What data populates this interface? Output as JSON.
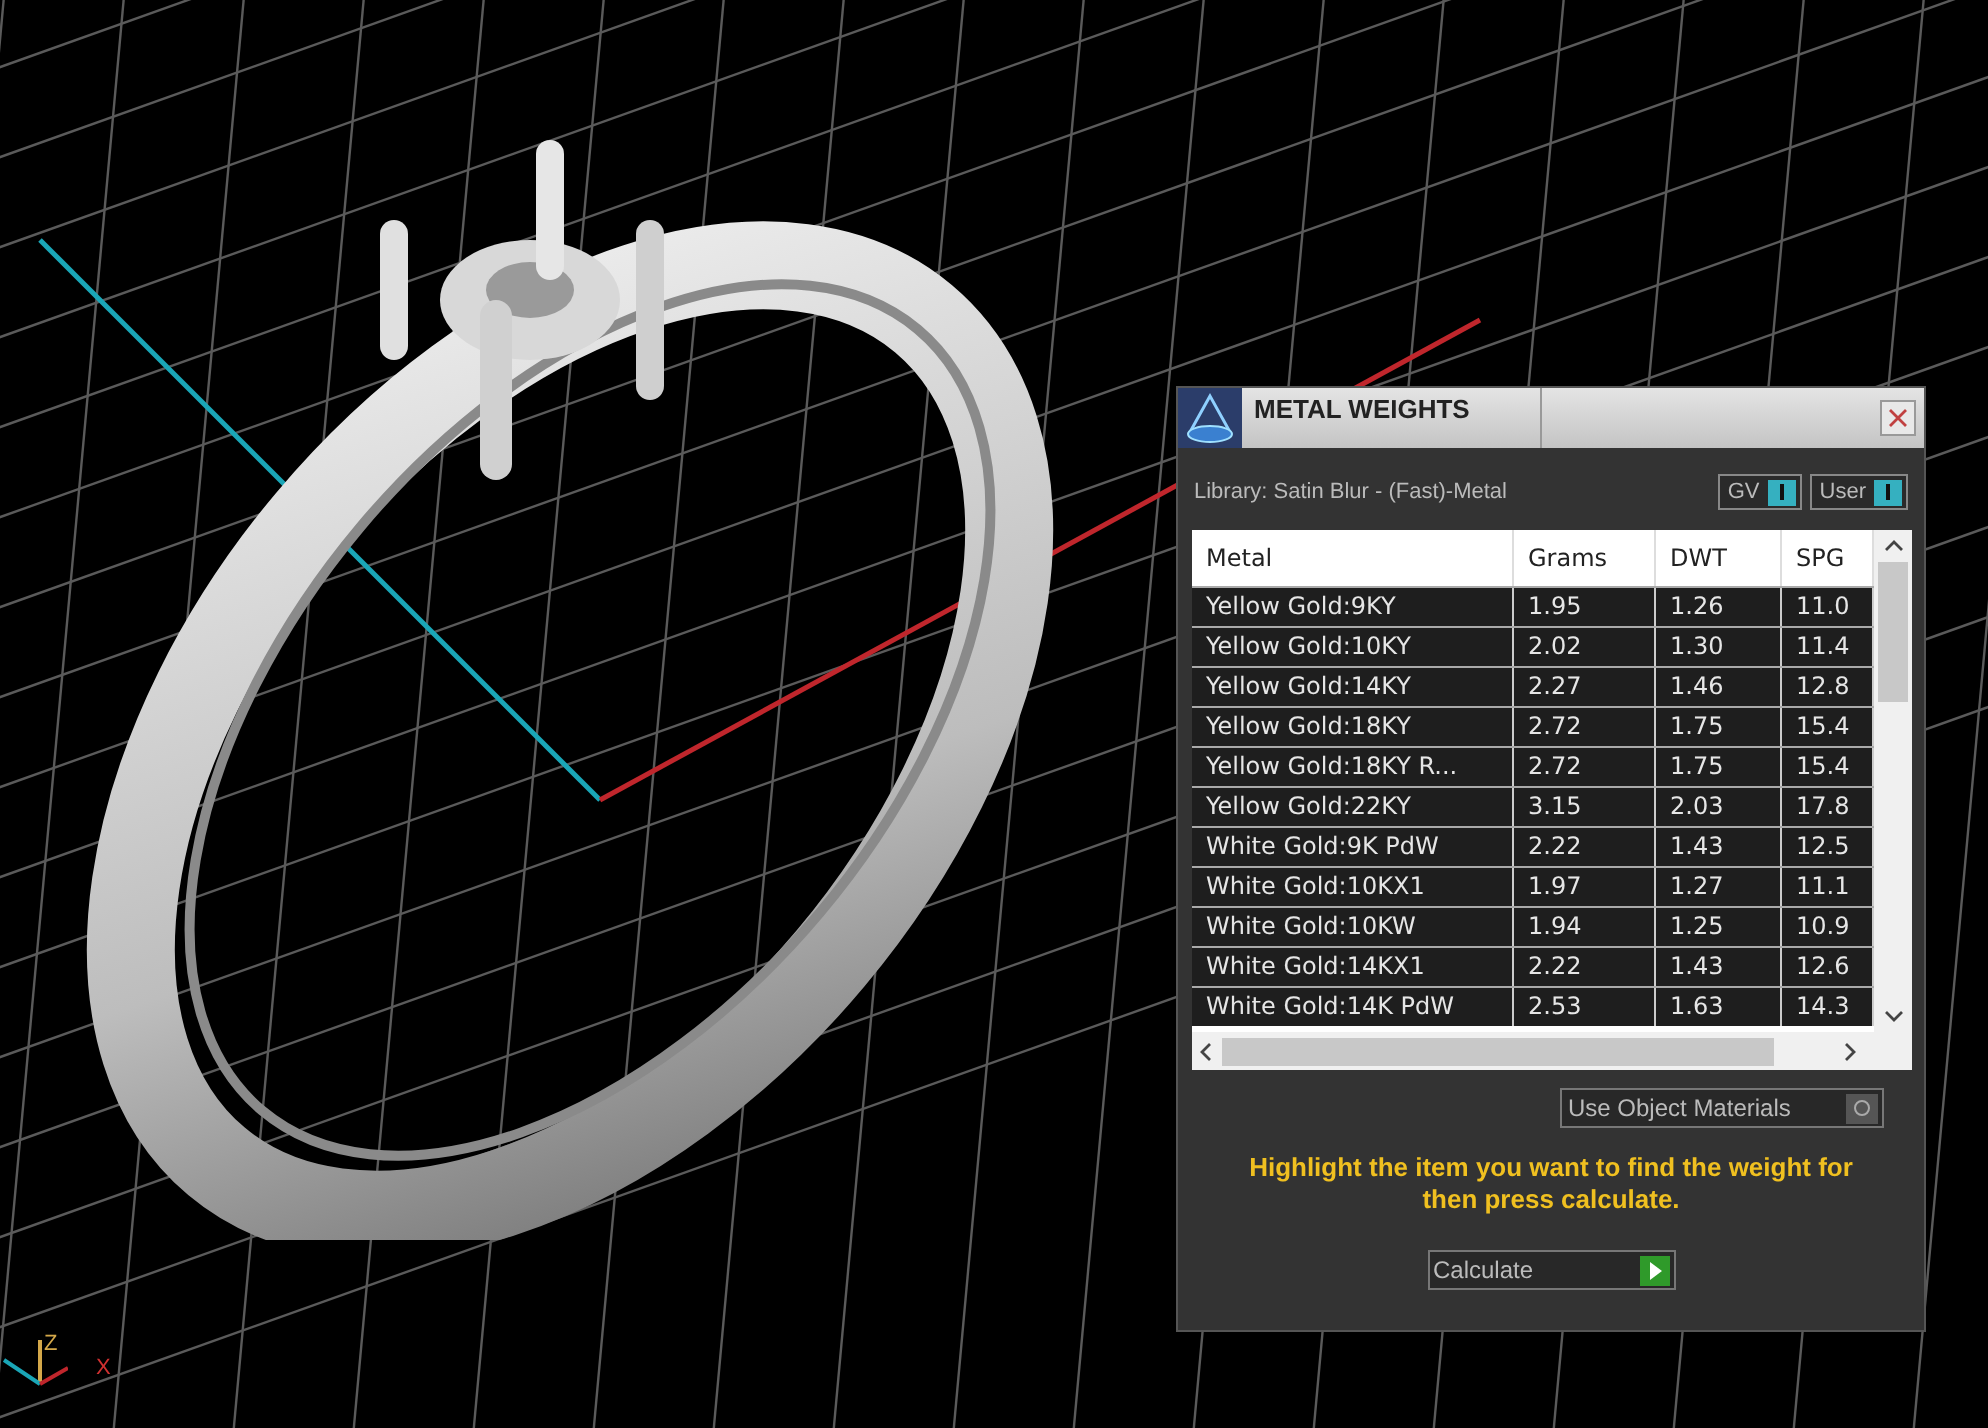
{
  "viewport": {
    "axis_labels": [
      "Z",
      "X"
    ]
  },
  "panel": {
    "title": "METAL WEIGHTS",
    "library": "Library: Satin Blur - (Fast)-Metal",
    "toggles": [
      {
        "label": "GV",
        "on": true
      },
      {
        "label": "User",
        "on": true
      }
    ],
    "table": {
      "columns": [
        "Metal",
        "Grams",
        "DWT",
        "SPG"
      ],
      "rows": [
        {
          "selected": false,
          "cells": [
            "Yellow Gold:9KY",
            "1.95",
            "1.26",
            "11.0"
          ]
        },
        {
          "selected": false,
          "cells": [
            "Yellow Gold:10KY",
            "2.02",
            "1.30",
            "11.4"
          ]
        },
        {
          "selected": false,
          "cells": [
            "Yellow Gold:14KY",
            "2.27",
            "1.46",
            "12.8"
          ]
        },
        {
          "selected": false,
          "cells": [
            "Yellow Gold:18KY",
            "2.72",
            "1.75",
            "15.4"
          ]
        },
        {
          "selected": false,
          "cells": [
            "Yellow Gold:18KY R...",
            "2.72",
            "1.75",
            "15.4"
          ]
        },
        {
          "selected": false,
          "cells": [
            "Yellow Gold:22KY",
            "3.15",
            "2.03",
            "17.8"
          ]
        },
        {
          "selected": false,
          "cells": [
            "White Gold:9K PdW",
            "2.22",
            "1.43",
            "12.5"
          ]
        },
        {
          "selected": false,
          "cells": [
            "White Gold:10KX1",
            "1.97",
            "1.27",
            "11.1"
          ]
        },
        {
          "selected": false,
          "cells": [
            "White Gold:10KW",
            "1.94",
            "1.25",
            "10.9"
          ]
        },
        {
          "selected": false,
          "cells": [
            "White Gold:14KX1",
            "2.22",
            "1.43",
            "12.6"
          ]
        },
        {
          "selected": false,
          "cells": [
            "White Gold:14K PdW",
            "2.53",
            "1.63",
            "14.3"
          ]
        }
      ]
    },
    "use_object_materials": {
      "label": "Use Object Materials",
      "on": false
    },
    "hint": "Highlight the item you want to find the weight for then press calculate.",
    "calculate_button": "Calculate"
  }
}
